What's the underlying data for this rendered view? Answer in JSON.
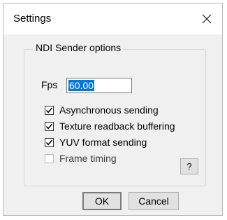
{
  "window": {
    "title": "Settings"
  },
  "group": {
    "legend": "NDI Sender options"
  },
  "fps": {
    "label": "Fps",
    "value": "60.00"
  },
  "options": [
    {
      "label": "Asynchronous sending",
      "checked": true
    },
    {
      "label": "Texture readback buffering",
      "checked": true
    },
    {
      "label": "YUV format sending",
      "checked": true
    },
    {
      "label": "Frame timing",
      "checked": false
    }
  ],
  "help_label": "?",
  "buttons": {
    "ok": "OK",
    "cancel": "Cancel"
  }
}
